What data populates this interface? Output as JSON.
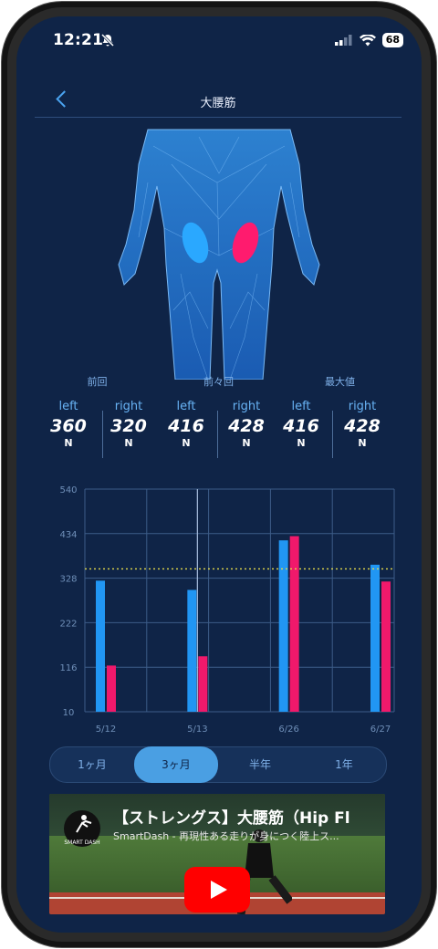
{
  "status": {
    "time": "12:21",
    "battery": "68"
  },
  "nav": {
    "title": "大腰筋"
  },
  "stats": {
    "groups": [
      "前回",
      "前々回",
      "最大値"
    ],
    "values": [
      {
        "side": "left",
        "value": "360",
        "unit": "N"
      },
      {
        "side": "right",
        "value": "320",
        "unit": "N"
      },
      {
        "side": "left",
        "value": "416",
        "unit": "N"
      },
      {
        "side": "right",
        "value": "428",
        "unit": "N"
      },
      {
        "side": "left",
        "value": "416",
        "unit": "N"
      },
      {
        "side": "right",
        "value": "428",
        "unit": "N"
      }
    ]
  },
  "chart_data": {
    "type": "bar",
    "categories": [
      "5/12",
      "5/13",
      "6/26",
      "6/27"
    ],
    "series": [
      {
        "values": [
          322,
          300,
          418,
          360
        ],
        "color": "#2196f3"
      },
      {
        "values": [
          120,
          142,
          428,
          320
        ],
        "color": "#f0196b"
      }
    ],
    "yticks": [
      "540",
      "434",
      "328",
      "222",
      "116",
      "10"
    ],
    "ylim": [
      10,
      540
    ],
    "reference_line": 350,
    "grid": true
  },
  "periods": {
    "options": [
      "1ヶ月",
      "3ヶ月",
      "半年",
      "1年"
    ],
    "selected": "3ヶ月"
  },
  "video": {
    "title": "【ストレングス】大腰筋（Hip Fl",
    "subtitle": "SmartDash - 再現性ある走りが身につく陸上ス...",
    "logo_text": "SMART DASH"
  }
}
